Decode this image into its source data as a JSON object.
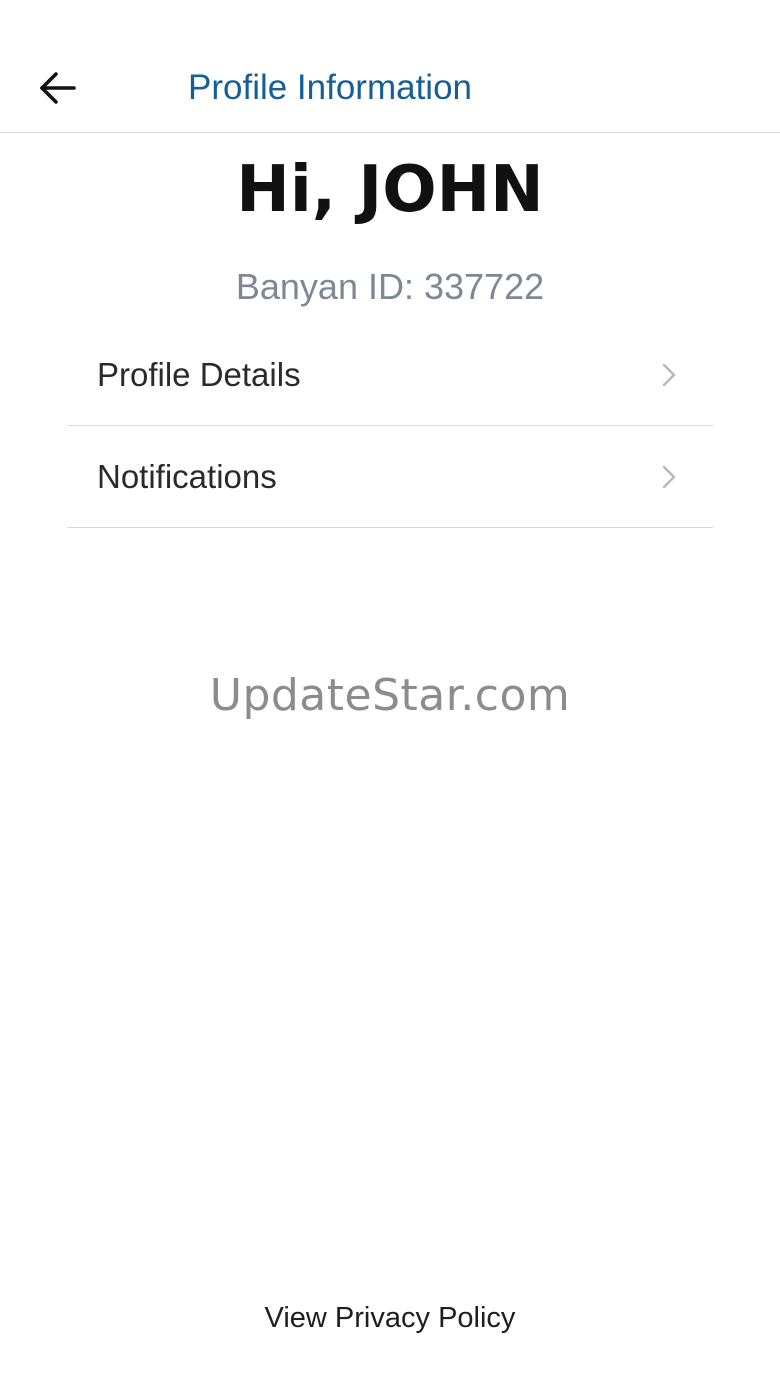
{
  "header": {
    "back_icon": "arrow-left-icon",
    "title": "Profile Information"
  },
  "profile": {
    "greeting": "Hi, JOHN",
    "banyan_id": "Banyan ID: 337722"
  },
  "menu": {
    "items": [
      {
        "label": "Profile Details",
        "icon": "chevron-right-icon"
      },
      {
        "label": "Notifications",
        "icon": "chevron-right-icon"
      }
    ]
  },
  "watermark": "UpdateStar.com",
  "footer": {
    "privacy_label": "View Privacy Policy"
  },
  "colors": {
    "accent": "#155f96",
    "muted": "#7d8894",
    "divider": "#d8d8d8",
    "background": "#ffffff"
  }
}
